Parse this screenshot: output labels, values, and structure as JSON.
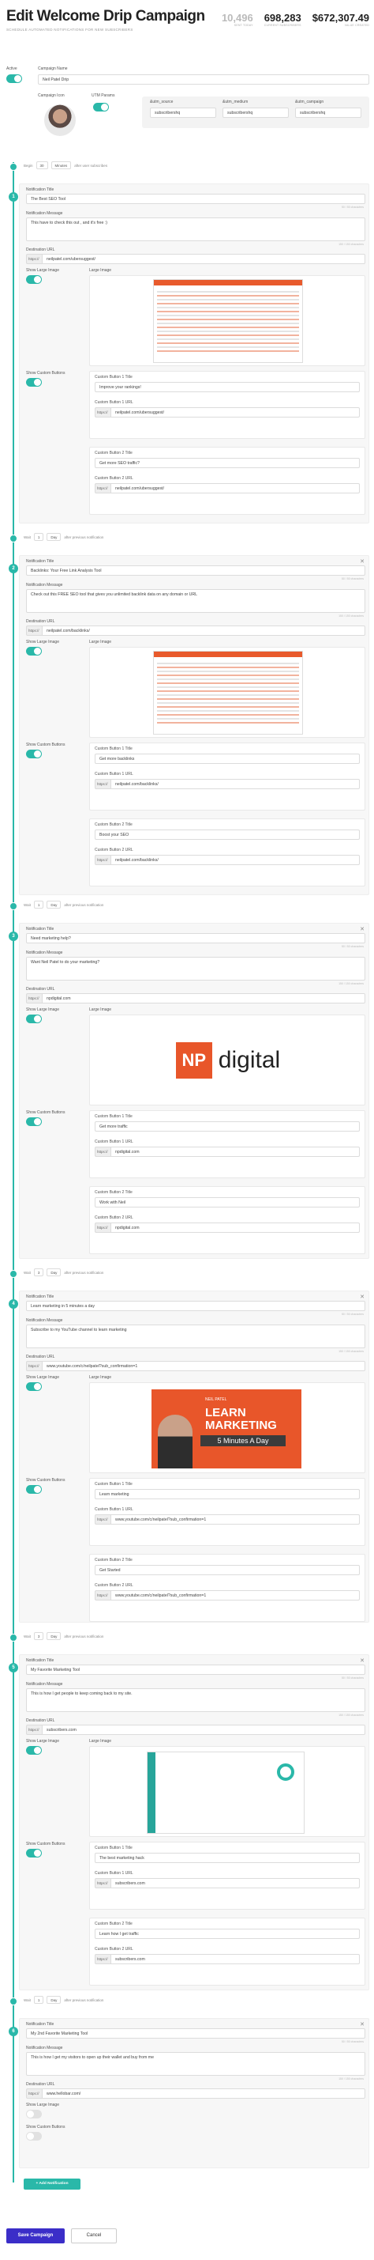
{
  "header": {
    "title": "Edit Welcome Drip Campaign",
    "subtitle": "SCHEDULE AUTOMATED NOTIFICATIONS FOR NEW SUBSCRIBERS",
    "stats": [
      {
        "value": "10,496",
        "label": "SENT TODAY"
      },
      {
        "value": "698,283",
        "label": "CURRENT SUBSCRIBERS"
      },
      {
        "value": "$672,307.49",
        "label": "VALUE CREATED"
      }
    ]
  },
  "campaign": {
    "active_label": "Active",
    "name_label": "Campaign Name",
    "name_value": "Neil Patel Drip",
    "icon_label": "Campaign Icon",
    "utm_label": "UTM Params",
    "utm": [
      {
        "label": "&utm_source",
        "value": "subscribershq"
      },
      {
        "label": "&utm_medium",
        "value": "subscribershq"
      },
      {
        "label": "&utm_campaign",
        "value": "subscribershq"
      }
    ]
  },
  "labels": {
    "title": "Notification Title",
    "message": "Notification Message",
    "dest": "Destination URL",
    "show_img": "Show Large Image",
    "image": "Large Image",
    "show_btns": "Show Custom Buttons",
    "b1t": "Custom Button 1 Title",
    "b1u": "Custom Button 1 URL",
    "b2t": "Custom Button 2 Title",
    "b2u": "Custom Button 2 URL",
    "prefix": "https://",
    "count_title": "50 / 50 characters",
    "count_msg": "150 / 150 characters",
    "after_sub": "after user subscribes",
    "after_prev": "after previous notification",
    "begin": "Begin",
    "wait": "Wait"
  },
  "notifications": [
    {
      "n": "1",
      "delay": "30",
      "unit": "Minutes",
      "title": "The Best SEO Tool",
      "message": "This have to check this out , and it's free :)",
      "url": "neilpatel.com/ubersuggest/",
      "b1t": "Improve your rankings!",
      "b1u": "neilpatel.com/ubersuggest/",
      "b2t": "Get more SEO traffic?",
      "b2u": "neilpatel.com/ubersuggest/"
    },
    {
      "n": "2",
      "delay": "1",
      "unit": "Day",
      "title": "Backlinks: Your Free Link Analysis Tool",
      "message": "Check out this FREE SEO tool that gives you unlimited backlink data on any domain or URL",
      "url": "neilpatel.com/backlinks/",
      "b1t": "Get more backlinks",
      "b1u": "neilpatel.com/backlinks/",
      "b2t": "Boost your SEO",
      "b2u": "neilpatel.com/backlinks/"
    },
    {
      "n": "3",
      "delay": "1",
      "unit": "Day",
      "title": "Need marketing help?",
      "message": "Want Neil Patel to do your marketing?",
      "url": "npdigital.com",
      "b1t": "Get more traffic",
      "b1u": "npdigital.com",
      "b2t": "Work with Neil",
      "b2u": "npdigital.com"
    },
    {
      "n": "4",
      "delay": "3",
      "unit": "Day",
      "title": "Learn marketing in 5 minutes a day",
      "message": "Subscribe to my YouTube channel to learn marketing",
      "url": "www.youtube.com/c/neilpatel?sub_confirmation=1",
      "b1t": "Learn marketing",
      "b1u": "www.youtube.com/c/neilpatel?sub_confirmation=1",
      "b2t": "Get Started",
      "b2u": "www.youtube.com/c/neilpatel?sub_confirmation=1"
    },
    {
      "n": "5",
      "delay": "3",
      "unit": "Day",
      "title": "My Favorite Marketing Tool",
      "message": "This is how I get people to keep coming back to my site.",
      "url": "subscribers.com",
      "b1t": "The best marketing hack",
      "b1u": "subscribers.com",
      "b2t": "Learn how I get traffic",
      "b2u": "subscribers.com"
    },
    {
      "n": "6",
      "delay": "1",
      "unit": "Day",
      "title": "My 2nd Favorite Marketing Tool",
      "message": "This is how I get my visitors to open up their wallet and buy from me",
      "url": "www.hellobar.com/"
    }
  ],
  "images": {
    "np_mark": "NP",
    "np_word": "digital",
    "yt_line1": "LEARN",
    "yt_line2": "MARKETING",
    "yt_band": "5 Minutes A Day",
    "yt_small": "NEIL PATEL"
  },
  "actions": {
    "add": "+ Add Notification",
    "save": "Save Campaign",
    "cancel": "Cancel"
  },
  "colors": {
    "accent": "#2ab8a9",
    "save": "#3b2ec8",
    "brand": "#e8562a"
  }
}
